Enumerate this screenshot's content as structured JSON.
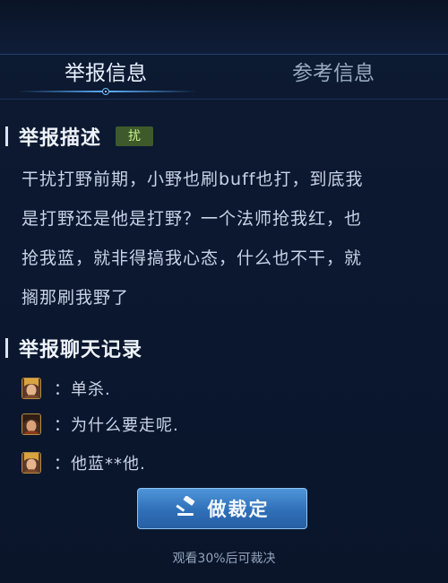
{
  "tabs": [
    {
      "label": "举报信息",
      "active": true
    },
    {
      "label": "参考信息",
      "active": false
    }
  ],
  "report_description": {
    "title": "举报描述",
    "tag": "扰",
    "tag_color": "#c9f08c",
    "lines": [
      "干扰打野前期，小野也刷buff也打，到底我",
      "是打野还是他是打野？一个法师抢我红，也",
      "抢我蓝，就非得搞我心态，什么也不干，就",
      "搁那刷我野了"
    ]
  },
  "chat_record": {
    "title": "举报聊天记录",
    "messages": [
      {
        "avatar": "hero-avatar-icon",
        "text": "：单杀."
      },
      {
        "avatar": "hero-avatar-icon",
        "text": "：为什么要走呢."
      },
      {
        "avatar": "hero-avatar-icon",
        "text": "：他蓝**他."
      }
    ]
  },
  "judge_button": {
    "label": "做裁定",
    "icon": "gavel-icon",
    "accent": "#2f6fb8"
  },
  "hint": "观看30%后可裁决"
}
